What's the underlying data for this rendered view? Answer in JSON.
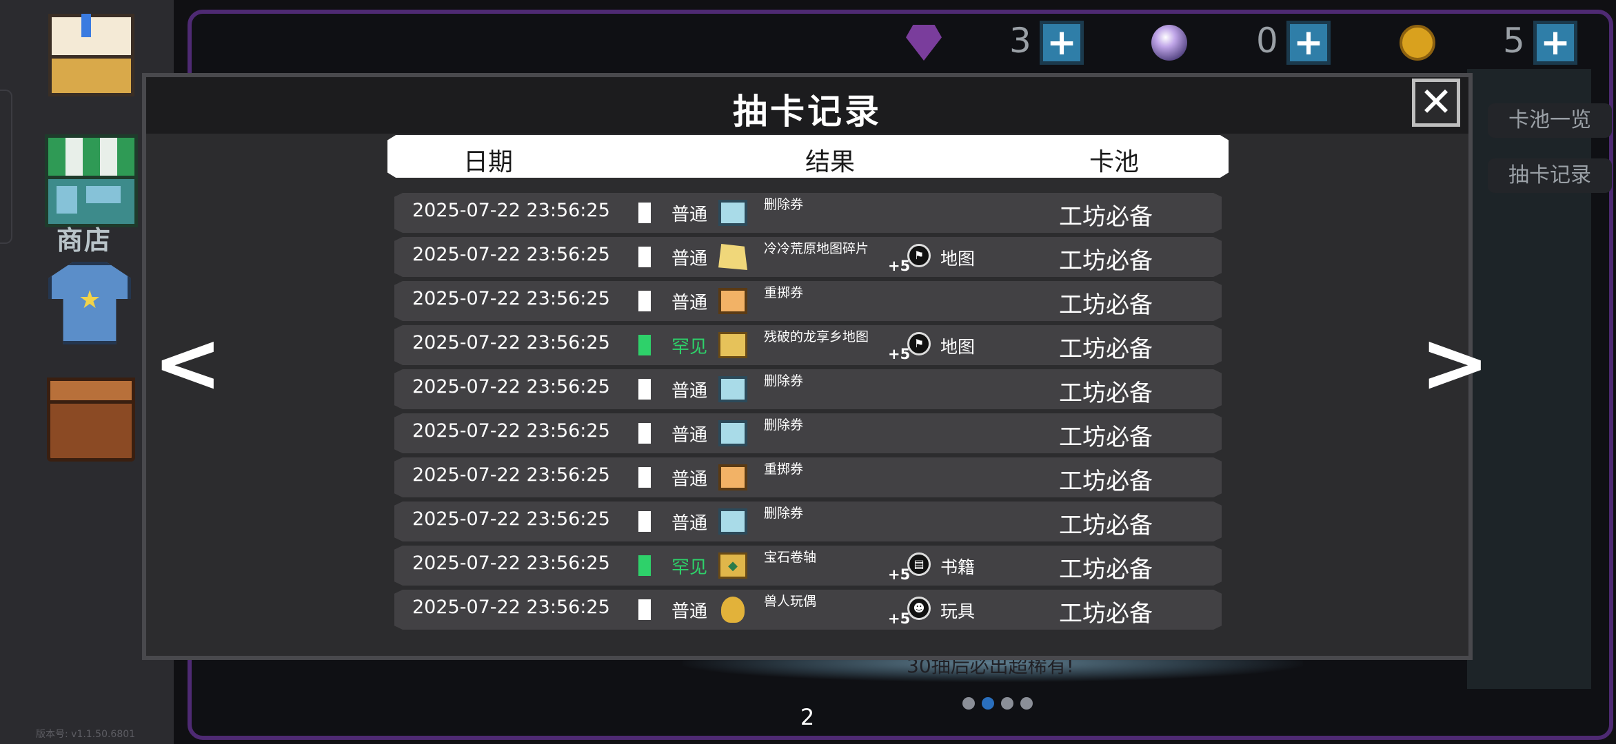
{
  "modal": {
    "title": "抽卡记录",
    "close_label": "✕",
    "prev_label": "<",
    "next_label": ">",
    "page": "2"
  },
  "columns": {
    "date": "日期",
    "result": "结果",
    "pool": "卡池"
  },
  "rows": [
    {
      "date": "2025-07-22 23:56:25",
      "rarity": "普通",
      "rare": false,
      "icon": "delete-ticket-icon",
      "name": "删除券",
      "plus": "",
      "tag_icon": "",
      "tag": "",
      "pool": "工坊必备"
    },
    {
      "date": "2025-07-22 23:56:25",
      "rarity": "普通",
      "rare": false,
      "icon": "map-fragment-icon",
      "name": "冷冷荒原地图碎片",
      "plus": "+5",
      "tag_icon": "flag-icon",
      "tag": "地图",
      "pool": "工坊必备"
    },
    {
      "date": "2025-07-22 23:56:25",
      "rarity": "普通",
      "rare": false,
      "icon": "reroll-ticket-icon",
      "name": "重掷券",
      "plus": "",
      "tag_icon": "",
      "tag": "",
      "pool": "工坊必备"
    },
    {
      "date": "2025-07-22 23:56:25",
      "rarity": "罕见",
      "rare": true,
      "icon": "map-icon",
      "name": "残破的龙享乡地图",
      "plus": "+5",
      "tag_icon": "flag-icon",
      "tag": "地图",
      "pool": "工坊必备"
    },
    {
      "date": "2025-07-22 23:56:25",
      "rarity": "普通",
      "rare": false,
      "icon": "delete-ticket-icon",
      "name": "删除券",
      "plus": "",
      "tag_icon": "",
      "tag": "",
      "pool": "工坊必备"
    },
    {
      "date": "2025-07-22 23:56:25",
      "rarity": "普通",
      "rare": false,
      "icon": "delete-ticket-icon",
      "name": "删除券",
      "plus": "",
      "tag_icon": "",
      "tag": "",
      "pool": "工坊必备"
    },
    {
      "date": "2025-07-22 23:56:25",
      "rarity": "普通",
      "rare": false,
      "icon": "reroll-ticket-icon",
      "name": "重掷券",
      "plus": "",
      "tag_icon": "",
      "tag": "",
      "pool": "工坊必备"
    },
    {
      "date": "2025-07-22 23:56:25",
      "rarity": "普通",
      "rare": false,
      "icon": "delete-ticket-icon",
      "name": "删除券",
      "plus": "",
      "tag_icon": "",
      "tag": "",
      "pool": "工坊必备"
    },
    {
      "date": "2025-07-22 23:56:25",
      "rarity": "罕见",
      "rare": true,
      "icon": "gem-scroll-icon",
      "name": "宝石卷轴",
      "plus": "+5",
      "tag_icon": "book-icon",
      "tag": "书籍",
      "pool": "工坊必备"
    },
    {
      "date": "2025-07-22 23:56:25",
      "rarity": "普通",
      "rare": false,
      "icon": "orc-doll-icon",
      "name": "兽人玩偶",
      "plus": "+5",
      "tag_icon": "toy-icon",
      "tag": "玩具",
      "pool": "工坊必备"
    }
  ],
  "currency": [
    {
      "icon": "gem-icon",
      "value": "3"
    },
    {
      "icon": "orb-icon",
      "value": "0"
    },
    {
      "icon": "coin-icon",
      "value": "5"
    }
  ],
  "sidebar": {
    "shop_label": "商店",
    "version": "版本号: v1.1.50.6801"
  },
  "right_buttons": {
    "pool_list": "卡池一览",
    "draw_history": "抽卡记录"
  },
  "background": {
    "hint_text": "30抽后必出超稀有!"
  },
  "colors": {
    "rare": "#2ed16a",
    "common": "#ffffff",
    "plus_button": "#2f7ea8",
    "frame": "#4e2a73"
  }
}
